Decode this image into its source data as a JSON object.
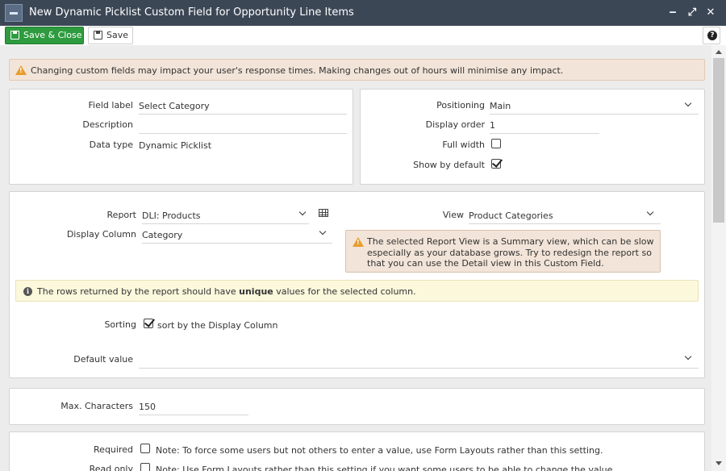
{
  "window": {
    "title": "New Dynamic Picklist Custom Field for Opportunity Line Items"
  },
  "toolbar": {
    "save_close_label": "Save & Close",
    "save_label": "Save",
    "help_label": "?"
  },
  "warning": {
    "text": "Changing custom fields may impact your user's response times. Making changes out of hours will minimise any impact."
  },
  "general": {
    "field_label": {
      "label": "Field label",
      "value": "Select Category"
    },
    "description": {
      "label": "Description",
      "value": ""
    },
    "data_type": {
      "label": "Data type",
      "value": "Dynamic Picklist"
    },
    "positioning": {
      "label": "Positioning",
      "value": "Main"
    },
    "display_order": {
      "label": "Display order",
      "value": "1"
    },
    "full_width": {
      "label": "Full width",
      "checked": false
    },
    "show_by_default": {
      "label": "Show by default",
      "checked": true
    }
  },
  "picklist": {
    "report": {
      "label": "Report",
      "value": "DLI: Products"
    },
    "display_column": {
      "label": "Display Column",
      "value": "Category"
    },
    "view": {
      "label": "View",
      "value": "Product Categories"
    },
    "summary_warning": "The selected Report View is a Summary view, which can be slow especially as your database grows. Try to redesign the report so that you can use the Detail view in this Custom Field.",
    "info_pre": "The rows returned by the report should have ",
    "info_bold": "unique",
    "info_post": " values for the selected column.",
    "sorting": {
      "label": "Sorting",
      "checked": true,
      "text": "sort by the Display Column"
    },
    "default_value": {
      "label": "Default value",
      "value": ""
    }
  },
  "limits": {
    "max_characters": {
      "label": "Max. Characters",
      "value": "150"
    }
  },
  "options": {
    "required": {
      "label": "Required",
      "checked": false,
      "note": "Note: To force some users but not others to enter a value, use Form Layouts rather than this setting."
    },
    "read_only": {
      "label": "Read only",
      "checked": false,
      "note": "Note: Use Form Layouts rather than this setting if you want some users to be able to change the value."
    }
  }
}
